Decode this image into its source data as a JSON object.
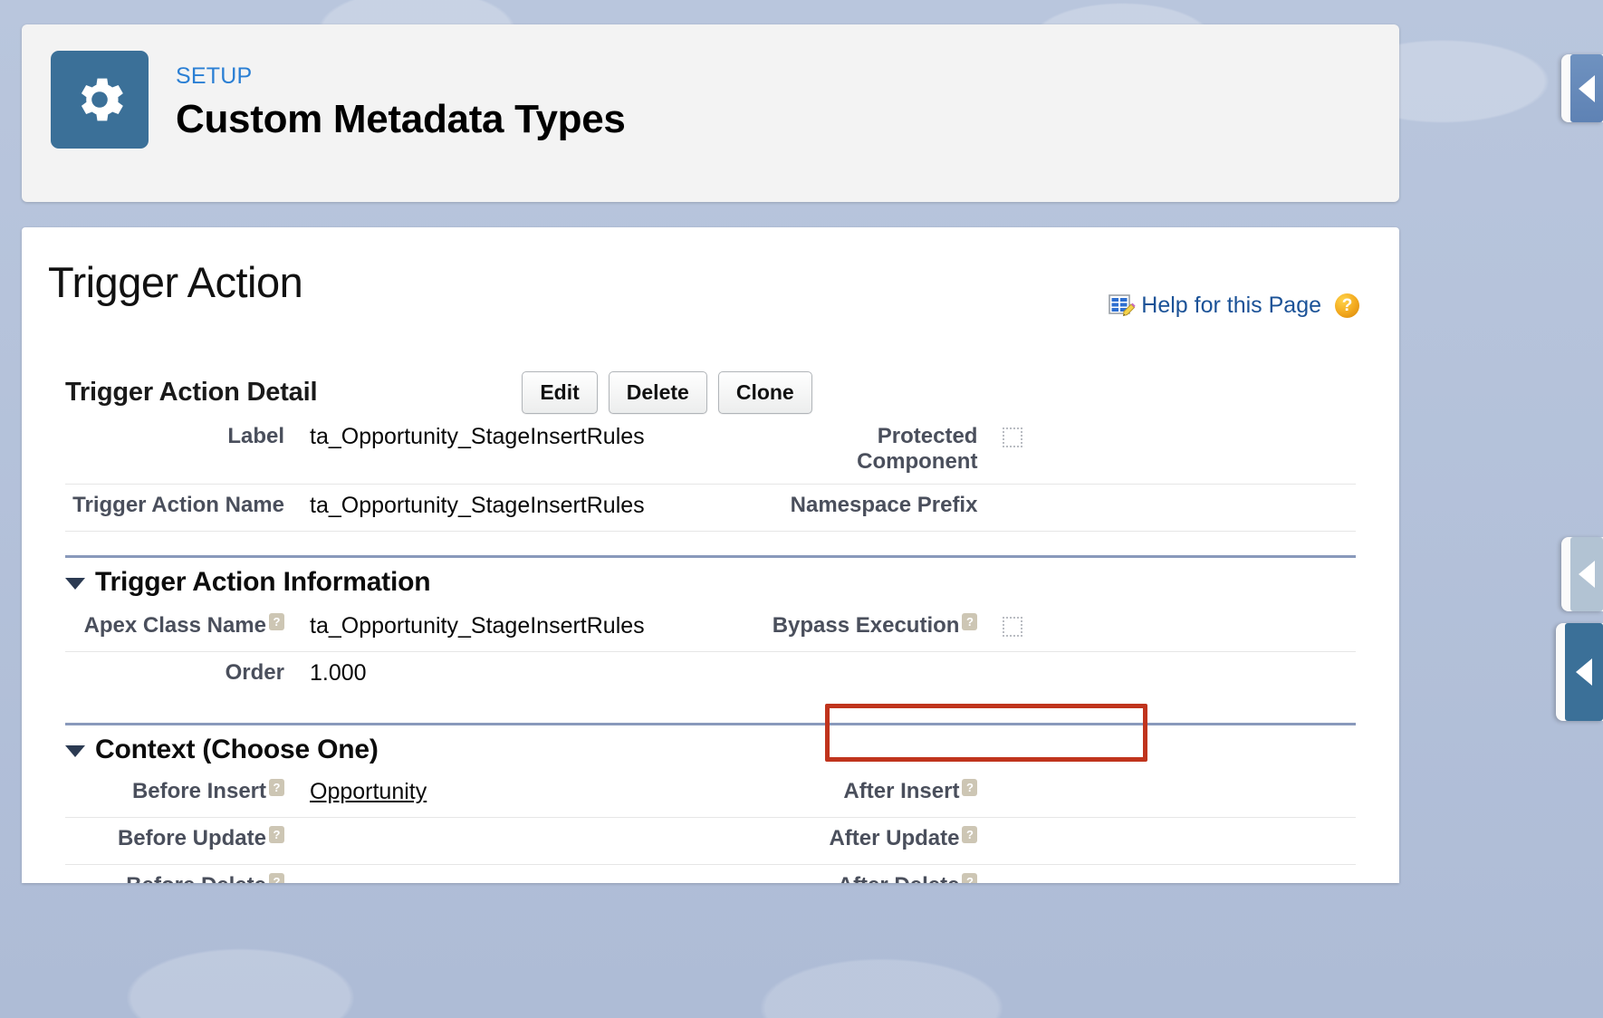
{
  "setup_header": {
    "kicker": "SETUP",
    "title": "Custom Metadata Types",
    "gear_icon": "gear-icon"
  },
  "page": {
    "title": "Trigger Action",
    "help_link": "Help for this Page",
    "help_table_icon": "table-edit-icon",
    "help_question_icon": "question-mark-icon"
  },
  "detail_section": {
    "heading": "Trigger Action Detail",
    "buttons": [
      {
        "label": "Edit",
        "name": "edit-button"
      },
      {
        "label": "Delete",
        "name": "delete-button"
      },
      {
        "label": "Clone",
        "name": "clone-button"
      }
    ],
    "rows": [
      {
        "left_label": "Label",
        "left_value": "ta_Opportunity_StageInsertRules",
        "right_label": "Protected Component",
        "right_type": "checkbox",
        "right_checked": false
      },
      {
        "left_label": "Trigger Action Name",
        "left_value": "ta_Opportunity_StageInsertRules",
        "right_label": "Namespace Prefix",
        "right_type": "text",
        "right_value": ""
      }
    ]
  },
  "info_section": {
    "heading": "Trigger Action Information",
    "rows": [
      {
        "left_label": "Apex Class Name",
        "left_help": true,
        "left_value": "ta_Opportunity_StageInsertRules",
        "right_label": "Bypass Execution",
        "right_help": true,
        "right_type": "checkbox",
        "right_checked": false,
        "right_highlighted": true
      },
      {
        "left_label": "Order",
        "left_help": false,
        "left_value": "1.000",
        "right_label": "",
        "right_type": "none"
      }
    ]
  },
  "context_section": {
    "heading": "Context (Choose One)",
    "rows": [
      {
        "left_label": "Before Insert",
        "left_help": true,
        "left_value": "Opportunity",
        "left_is_link": true,
        "right_label": "After Insert",
        "right_help": true,
        "right_value": ""
      },
      {
        "left_label": "Before Update",
        "left_help": true,
        "left_value": "",
        "left_is_link": false,
        "right_label": "After Update",
        "right_help": true,
        "right_value": ""
      },
      {
        "left_label": "Before Delete",
        "left_help": true,
        "left_value": "",
        "left_is_link": false,
        "right_label": "After Delete",
        "right_help": true,
        "right_value": ""
      }
    ]
  },
  "edge_tabs": [
    {
      "name": "edge-tab-top",
      "icon": "chevron-left-icon"
    },
    {
      "name": "edge-tab-mid",
      "icon": "chevron-left-icon"
    },
    {
      "name": "edge-tab-low",
      "icon": "chevron-left-icon"
    }
  ],
  "colors": {
    "setup_tile": "#3b7098",
    "kicker_blue": "#2a7fd4",
    "link_blue": "#1b5297",
    "highlight_red": "#c0341d",
    "section_rule": "#8999bb",
    "label_gray": "#4a4f5c"
  }
}
